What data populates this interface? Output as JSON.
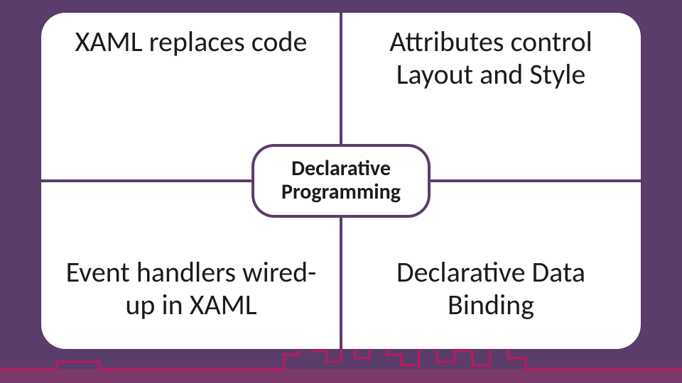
{
  "colors": {
    "background": "#5a3d6b",
    "panel": "#ffffff",
    "divider": "#5a3d6b",
    "skyline_outline": "#c2185b",
    "bottom_bar": "#7b3a6a"
  },
  "center": {
    "label": "Declarative\nProgramming"
  },
  "quadrants": {
    "top_left": {
      "text": "XAML replaces code"
    },
    "top_right": {
      "text": "Attributes control Layout and Style"
    },
    "bottom_left": {
      "text": "Event handlers wired-up in XAML"
    },
    "bottom_right": {
      "text": "Declarative Data Binding"
    }
  }
}
